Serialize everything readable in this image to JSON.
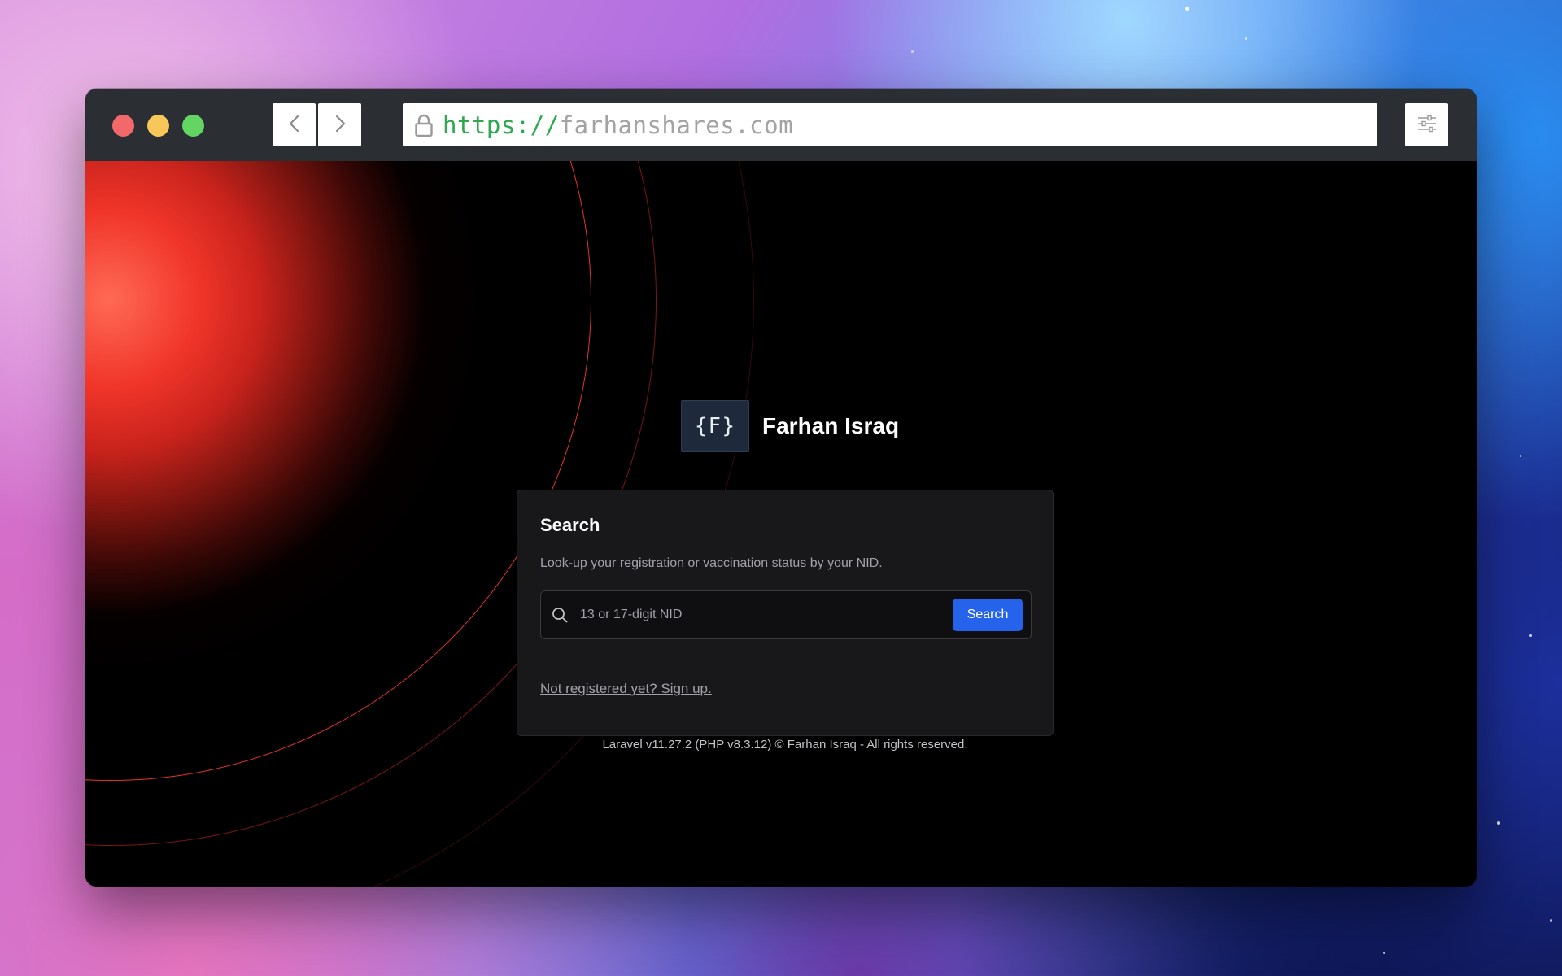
{
  "browser": {
    "url_scheme": "https://",
    "url_host": "farhanshares.com"
  },
  "brand": {
    "logo_text": "{F}",
    "name": "Farhan Israq"
  },
  "search_card": {
    "title": "Search",
    "description": "Look-up your registration or vaccination status by your NID.",
    "input_placeholder": "13 or 17-digit NID",
    "input_value": "",
    "button_label": "Search",
    "signup_link": "Not registered yet? Sign up."
  },
  "footer": {
    "text": "Laravel v11.27.2 (PHP v8.3.12) © Farhan Israq - All rights reserved."
  },
  "colors": {
    "accent": "#2563eb",
    "url_scheme": "#2fa84f",
    "glow": "#f0352a"
  },
  "icons": [
    "lock-icon",
    "back-arrow-icon",
    "forward-arrow-icon",
    "sliders-icon",
    "search-icon"
  ]
}
